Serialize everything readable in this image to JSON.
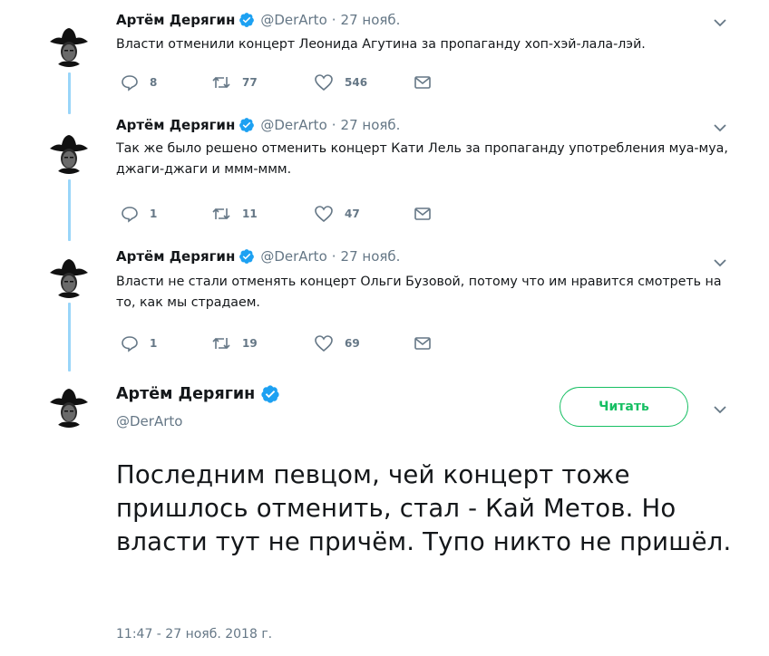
{
  "author": {
    "name": "Артём Дерягин",
    "handle": "@DerArto"
  },
  "icons": {
    "verified": "verified-badge-icon",
    "reply": "reply-icon",
    "retweet": "retweet-icon",
    "like": "heart-icon",
    "dm": "envelope-icon",
    "menu": "chevron-down-icon"
  },
  "colors": {
    "accent": "#1da1f2",
    "follow": "#17bf63",
    "muted": "#657786",
    "text": "#14171a"
  },
  "thread": [
    {
      "date": "27 нояб.",
      "text": "Власти отменили концерт Леонида Агутина за пропаганду хоп-хэй-лала-лэй.",
      "replies": "8",
      "retweets": "77",
      "likes": "546"
    },
    {
      "date": "27 нояб.",
      "text": "Так же было решено отменить концерт Кати Лель за пропаганду употребления муа-муа, джаги-джаги и ммм-ммм.",
      "replies": "1",
      "retweets": "11",
      "likes": "47"
    },
    {
      "date": "27 нояб.",
      "text": "Власти не стали отменять концерт Ольги Бузовой, потому что им нравится смотреть на то, как мы страдаем.",
      "replies": "1",
      "retweets": "19",
      "likes": "69"
    }
  ],
  "main": {
    "follow_label": "Читать",
    "text": "Последним певцом, чей концерт тоже пришлось отменить, стал - Кай Метов. Но власти тут не причём. Тупо никто не пришёл.",
    "timestamp": "11:47 - 27 нояб. 2018 г."
  },
  "dot": "·"
}
